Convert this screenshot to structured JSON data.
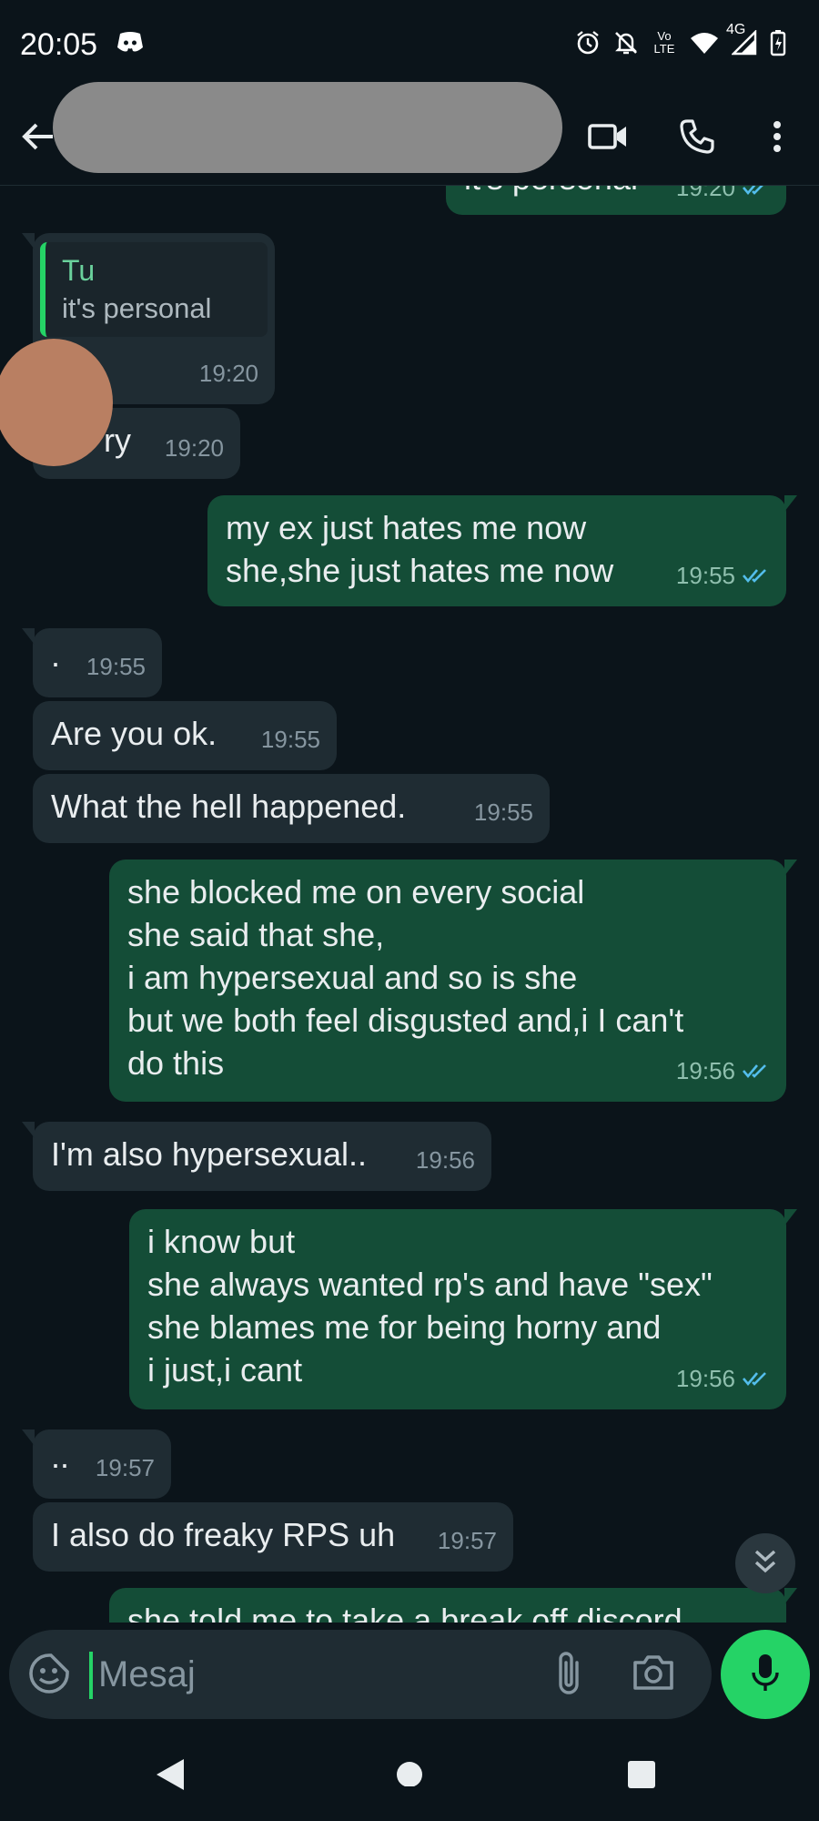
{
  "status_bar": {
    "time": "20:05",
    "network": "4G",
    "volte": "Vo LTE",
    "icons": [
      "discord-icon",
      "alarm-icon",
      "notifications-off-icon",
      "volte-icon",
      "wifi-icon",
      "signal-icon",
      "battery-charging-icon"
    ]
  },
  "header": {
    "icons": [
      "back-arrow-icon",
      "video-call-icon",
      "phone-icon",
      "more-vert-icon"
    ]
  },
  "messages": [
    {
      "dir": "out",
      "text": "it's personal",
      "time": "19:20",
      "ticks": "read"
    },
    {
      "dir": "in",
      "quote_author": "Tu",
      "quote_text": "it's personal",
      "text": "...",
      "time": "19:20"
    },
    {
      "dir": "in",
      "text": "...ry",
      "time": "19:20"
    },
    {
      "dir": "out",
      "text": "my ex just hates me now\nshe,she just hates me now",
      "time": "19:55",
      "ticks": "read"
    },
    {
      "dir": "in",
      "text": ".",
      "time": "19:55"
    },
    {
      "dir": "in",
      "text": "Are you ok.",
      "time": "19:55"
    },
    {
      "dir": "in",
      "text": "What the hell happened.",
      "time": "19:55"
    },
    {
      "dir": "out",
      "text": "she blocked me on every social\nshe said that she,\ni am hypersexual and so is she\nbut we both feel disgusted and,i I can't\ndo this",
      "time": "19:56",
      "ticks": "read"
    },
    {
      "dir": "in",
      "text": "I'm also hypersexual..",
      "time": "19:56"
    },
    {
      "dir": "out",
      "text": "i know but\nshe always wanted rp's and have \"sex\"\nshe blames me for being horny and\ni just,i cant",
      "time": "19:56",
      "ticks": "read"
    },
    {
      "dir": "in",
      "text": "..",
      "time": "19:57"
    },
    {
      "dir": "in",
      "text": "I also do freaky RPS uh",
      "time": "19:57"
    },
    {
      "dir": "out",
      "text": "she told me to take a break off discord",
      "time": "",
      "ticks": ""
    }
  ],
  "composer": {
    "placeholder": "Mesaj",
    "icons": [
      "sticker-icon",
      "attach-icon",
      "camera-icon",
      "mic-icon"
    ]
  },
  "navbar": {
    "icons": [
      "nav-back-icon",
      "nav-home-icon",
      "nav-recents-icon"
    ]
  },
  "colors": {
    "background": "#0b141a",
    "incoming_bubble": "#1f2c33",
    "outgoing_bubble": "#144d37",
    "accent": "#25d366",
    "read_ticks": "#53bdeb"
  }
}
